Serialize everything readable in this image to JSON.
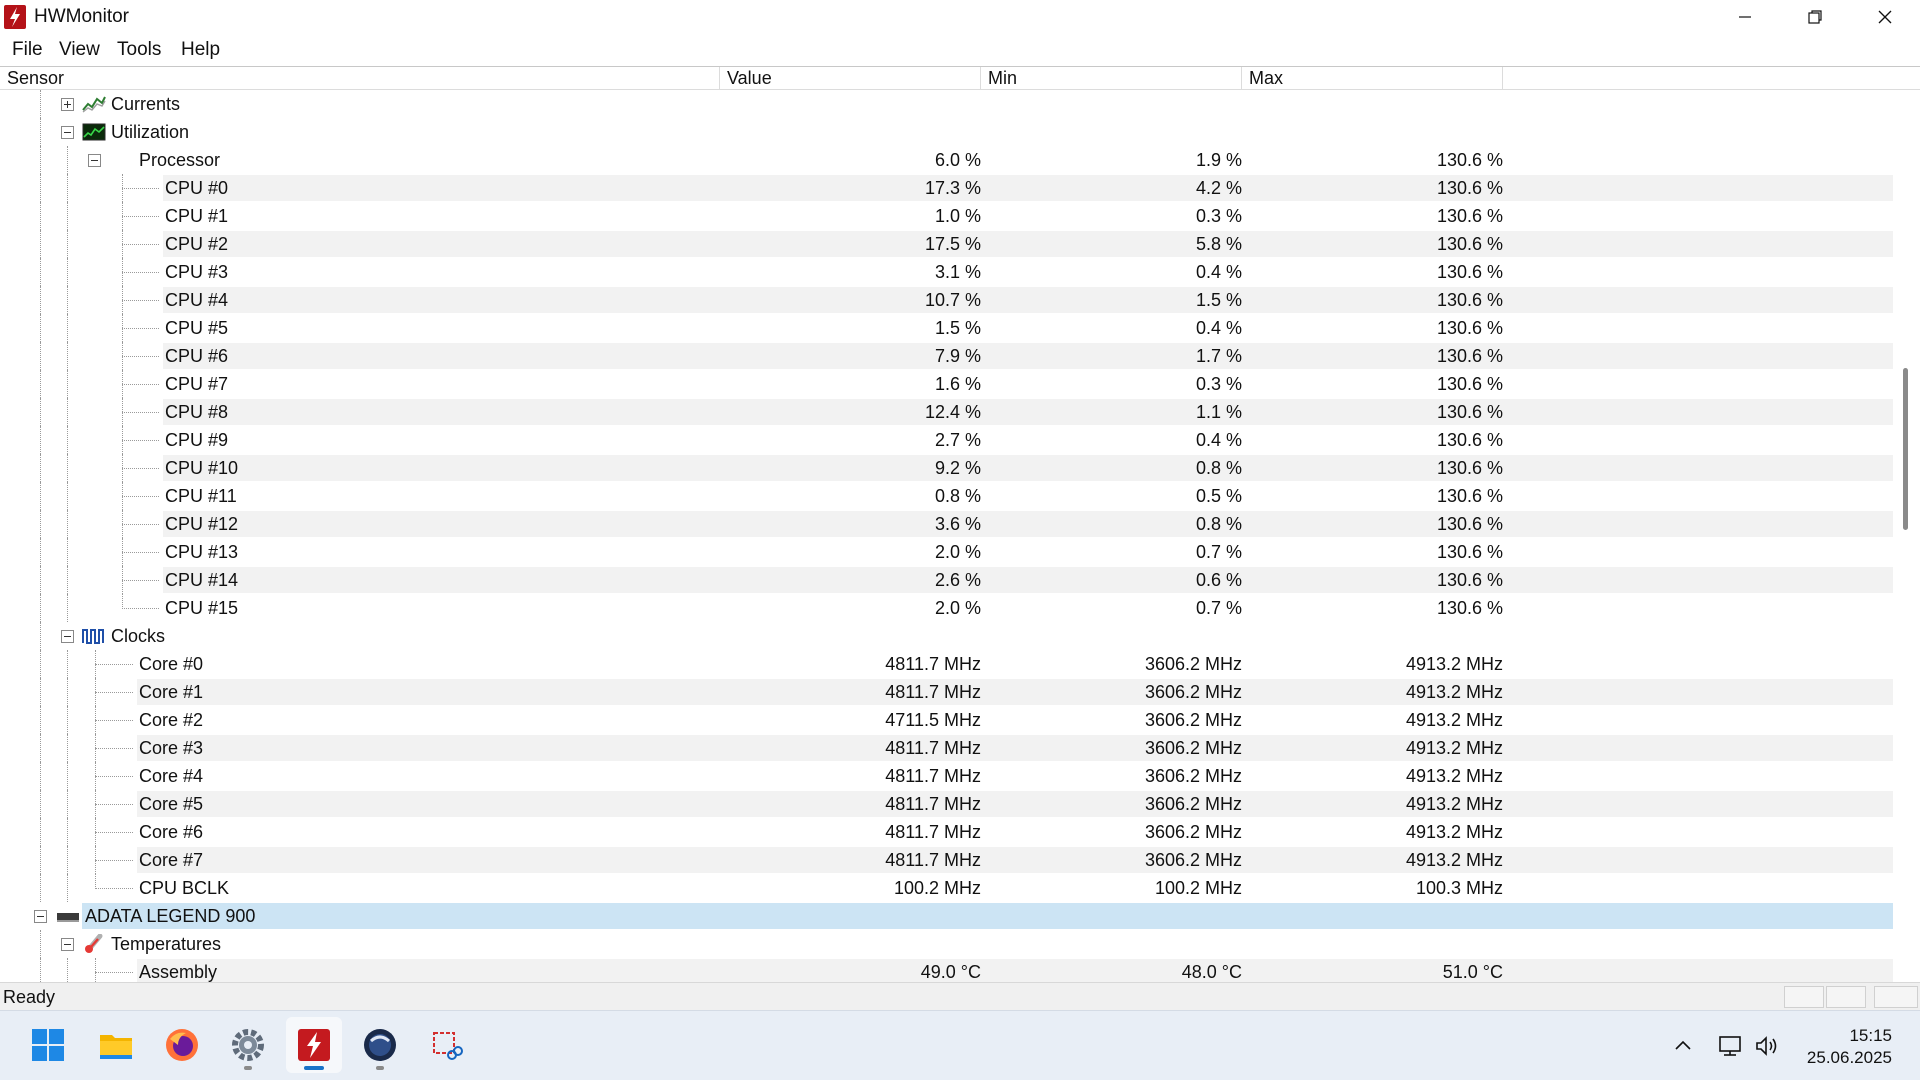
{
  "window": {
    "title": "HWMonitor"
  },
  "menu": {
    "items": [
      "File",
      "View",
      "Tools",
      "Help"
    ]
  },
  "columns": [
    "Sensor",
    "Value",
    "Min",
    "Max"
  ],
  "rows": [
    {
      "label": "Currents",
      "icon": "currents-icon",
      "expander": "plus",
      "kind": "category"
    },
    {
      "label": "Utilization",
      "icon": "utilization-icon",
      "expander": "minus",
      "kind": "category"
    },
    {
      "label": "Processor",
      "expander": "minus",
      "kind": "group",
      "value": "6.0 %",
      "min": "1.9 %",
      "max": "130.6 %"
    },
    {
      "label": "CPU #0",
      "kind": "sub",
      "value": "17.3 %",
      "min": "4.2 %",
      "max": "130.6 %"
    },
    {
      "label": "CPU #1",
      "kind": "sub",
      "value": "1.0 %",
      "min": "0.3 %",
      "max": "130.6 %"
    },
    {
      "label": "CPU #2",
      "kind": "sub",
      "value": "17.5 %",
      "min": "5.8 %",
      "max": "130.6 %"
    },
    {
      "label": "CPU #3",
      "kind": "sub",
      "value": "3.1 %",
      "min": "0.4 %",
      "max": "130.6 %"
    },
    {
      "label": "CPU #4",
      "kind": "sub",
      "value": "10.7 %",
      "min": "1.5 %",
      "max": "130.6 %"
    },
    {
      "label": "CPU #5",
      "kind": "sub",
      "value": "1.5 %",
      "min": "0.4 %",
      "max": "130.6 %"
    },
    {
      "label": "CPU #6",
      "kind": "sub",
      "value": "7.9 %",
      "min": "1.7 %",
      "max": "130.6 %"
    },
    {
      "label": "CPU #7",
      "kind": "sub",
      "value": "1.6 %",
      "min": "0.3 %",
      "max": "130.6 %"
    },
    {
      "label": "CPU #8",
      "kind": "sub",
      "value": "12.4 %",
      "min": "1.1 %",
      "max": "130.6 %"
    },
    {
      "label": "CPU #9",
      "kind": "sub",
      "value": "2.7 %",
      "min": "0.4 %",
      "max": "130.6 %"
    },
    {
      "label": "CPU #10",
      "kind": "sub",
      "value": "9.2 %",
      "min": "0.8 %",
      "max": "130.6 %"
    },
    {
      "label": "CPU #11",
      "kind": "sub",
      "value": "0.8 %",
      "min": "0.5 %",
      "max": "130.6 %"
    },
    {
      "label": "CPU #12",
      "kind": "sub",
      "value": "3.6 %",
      "min": "0.8 %",
      "max": "130.6 %"
    },
    {
      "label": "CPU #13",
      "kind": "sub",
      "value": "2.0 %",
      "min": "0.7 %",
      "max": "130.6 %"
    },
    {
      "label": "CPU #14",
      "kind": "sub",
      "value": "2.6 %",
      "min": "0.6 %",
      "max": "130.6 %"
    },
    {
      "label": "CPU #15",
      "kind": "sub",
      "value": "2.0 %",
      "min": "0.7 %",
      "max": "130.6 %"
    },
    {
      "label": "Clocks",
      "icon": "clocks-icon",
      "expander": "minus",
      "kind": "category"
    },
    {
      "label": "Core #0",
      "kind": "leaf",
      "value": "4811.7 MHz",
      "min": "3606.2 MHz",
      "max": "4913.2 MHz"
    },
    {
      "label": "Core #1",
      "kind": "leaf",
      "value": "4811.7 MHz",
      "min": "3606.2 MHz",
      "max": "4913.2 MHz"
    },
    {
      "label": "Core #2",
      "kind": "leaf",
      "value": "4711.5 MHz",
      "min": "3606.2 MHz",
      "max": "4913.2 MHz"
    },
    {
      "label": "Core #3",
      "kind": "leaf",
      "value": "4811.7 MHz",
      "min": "3606.2 MHz",
      "max": "4913.2 MHz"
    },
    {
      "label": "Core #4",
      "kind": "leaf",
      "value": "4811.7 MHz",
      "min": "3606.2 MHz",
      "max": "4913.2 MHz"
    },
    {
      "label": "Core #5",
      "kind": "leaf",
      "value": "4811.7 MHz",
      "min": "3606.2 MHz",
      "max": "4913.2 MHz"
    },
    {
      "label": "Core #6",
      "kind": "leaf",
      "value": "4811.7 MHz",
      "min": "3606.2 MHz",
      "max": "4913.2 MHz"
    },
    {
      "label": "Core #7",
      "kind": "leaf",
      "value": "4811.7 MHz",
      "min": "3606.2 MHz",
      "max": "4913.2 MHz"
    },
    {
      "label": "CPU BCLK",
      "kind": "leaf",
      "value": "100.2 MHz",
      "min": "100.2 MHz",
      "max": "100.3 MHz"
    },
    {
      "label": "ADATA LEGEND 900",
      "icon": "ssd-drive-icon",
      "expander": "minus",
      "kind": "device",
      "selected": true
    },
    {
      "label": "Temperatures",
      "icon": "thermometer-icon",
      "expander": "minus",
      "kind": "category"
    },
    {
      "label": "Assembly",
      "kind": "leaf",
      "value": "49.0 °C",
      "min": "48.0 °C",
      "max": "51.0 °C"
    }
  ],
  "status": {
    "text": "Ready"
  },
  "taskbar": {
    "apps": [
      "windows-start-icon",
      "file-explorer-icon",
      "firefox-icon",
      "settings-gear-icon",
      "hwmonitor-icon",
      "cinema4d-icon",
      "snipping-tool-icon"
    ],
    "active_app": "hwmonitor-icon",
    "clock_time": "15:15",
    "clock_date": "25.06.2025"
  },
  "colors": {
    "selection": "#cce4f4",
    "band": "#f2f2f2",
    "accent": "#b41218"
  }
}
